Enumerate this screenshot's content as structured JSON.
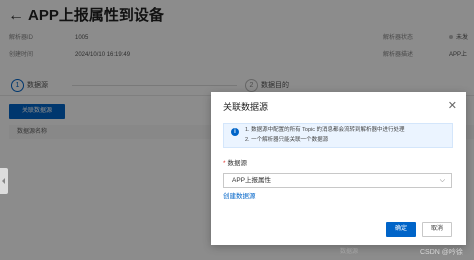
{
  "header": {
    "back_icon": "arrow-left-icon",
    "title": "APP上报属性到设备"
  },
  "meta": {
    "parser_id_label": "解析器ID",
    "parser_id_value": "1005",
    "created_label": "创建时间",
    "created_value": "2024/10/10 16:19:49",
    "status_label": "解析器状态",
    "status_value": "未发",
    "desc_label": "解析器描述",
    "desc_value": "APP上"
  },
  "steps": [
    {
      "number": "1",
      "label": "数据源"
    },
    {
      "number": "2",
      "label": "数据目的"
    }
  ],
  "main": {
    "associate_button": "关联数据源",
    "table_header": "数据源名称"
  },
  "dialog": {
    "title": "关联数据源",
    "notice_lines": [
      "1. 数据源中配置的所有 Topic 的消息都会流转到解析器中进行处理",
      "2. 一个解析器只能关联一个数据源"
    ],
    "field_required_mark": "*",
    "field_label": "数据源",
    "select_value": "APP上报属性",
    "create_link": "创建数据源",
    "confirm_button": "确定",
    "cancel_button": "取消"
  },
  "background_hint": "数据源",
  "watermark": "CSDN @吟徐",
  "colors": {
    "accent": "#0064c8",
    "overlay": "rgba(0,0,0,0.45)",
    "notice_bg": "#ebf4ff"
  }
}
